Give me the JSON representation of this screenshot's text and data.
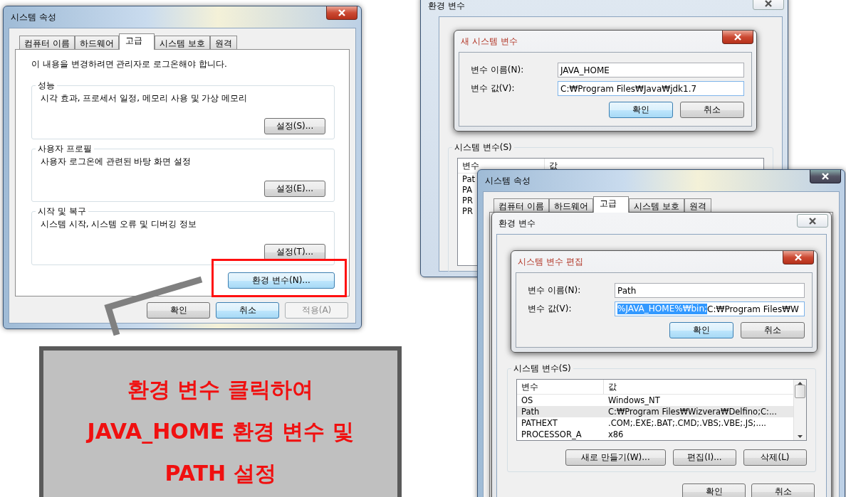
{
  "system_properties": {
    "title": "시스템 속성",
    "tabs": [
      {
        "label": "컴퓨터 이름",
        "selected": false
      },
      {
        "label": "하드웨어",
        "selected": false
      },
      {
        "label": "고급",
        "selected": true
      },
      {
        "label": "시스템 보호",
        "selected": false
      },
      {
        "label": "원격",
        "selected": false
      }
    ],
    "notice": "이 내용을 변경하려면 관리자로 로그온해야 합니다.",
    "groups": [
      {
        "title": "성능",
        "description": "시각 효과, 프로세서 일정, 메모리 사용 및 가상 메모리",
        "button": "설정(S)..."
      },
      {
        "title": "사용자 프로필",
        "description": "사용자 로그온에 관련된 바탕 화면 설정",
        "button": "설정(E)..."
      },
      {
        "title": "시작 및 복구",
        "description": "시스템 시작, 시스템 오류 및 디버깅 정보",
        "button": "설정(T)..."
      }
    ],
    "env_button": {
      "label": "환경 변수(N)...",
      "focused": true,
      "highlighted": true
    },
    "buttons": [
      {
        "label": "확인",
        "focused": false,
        "disabled": false
      },
      {
        "label": "취소",
        "focused": true,
        "disabled": false
      },
      {
        "label": "적용(A)",
        "focused": false,
        "disabled": true
      }
    ]
  },
  "callout": {
    "lines": [
      "환경 변수 클릭하여",
      "JAVA_HOME 환경 변수 및",
      "PATH 설정"
    ]
  },
  "env_window_back": {
    "title": "환경 변수",
    "dialog": {
      "title": "새 시스템 변수",
      "fields": [
        {
          "label": "변수 이름(N):",
          "value": "JAVA_HOME"
        },
        {
          "label": "변수 값(V):",
          "value": "C:₩Program Files₩Java₩jdk1.7"
        }
      ],
      "buttons": [
        {
          "label": "확인",
          "focused": true
        },
        {
          "label": "취소",
          "focused": false
        }
      ]
    },
    "system_vars_title": "시스템 변수(S)",
    "columns": [
      "변수",
      "값"
    ],
    "rows": [
      "Pat",
      "PA",
      "PR",
      "PR"
    ]
  },
  "env_window_front": {
    "window_title": "시스템 속성",
    "tabs": [
      {
        "label": "컴퓨터 이름",
        "selected": false
      },
      {
        "label": "하드웨어",
        "selected": false
      },
      {
        "label": "고급",
        "selected": true
      },
      {
        "label": "시스템 보호",
        "selected": false
      },
      {
        "label": "원격",
        "selected": false
      }
    ],
    "dialog_title": "환경 변수",
    "edit_dialog": {
      "title": "시스템 변수 편집",
      "fields": [
        {
          "label": "변수 이름(N):",
          "value": "Path"
        },
        {
          "label": "변수 값(V):",
          "value_selected": "%JAVA_HOME%₩bin;",
          "value": "C:₩Program Files₩W"
        }
      ],
      "buttons": [
        {
          "label": "확인",
          "focused": true
        },
        {
          "label": "취소",
          "focused": false
        }
      ]
    },
    "system_vars_title": "시스템 변수(S)",
    "columns": [
      "변수",
      "값"
    ],
    "rows": [
      {
        "name": "OS",
        "value": "Windows_NT",
        "selected": false
      },
      {
        "name": "Path",
        "value": "C:₩Program Files₩Wizvera₩Delfino;C:...",
        "selected": true
      },
      {
        "name": "PATHEXT",
        "value": ".COM;.EXE;.BAT;.CMD;.VBS;.VBE;.JS;....",
        "selected": false
      },
      {
        "name": "PROCESSOR_A",
        "value": "x86",
        "selected": false
      }
    ],
    "list_buttons": [
      "새로 만들기(W)...",
      "편집(I)...",
      "삭제(L)"
    ],
    "buttons": [
      {
        "label": "확인",
        "focused": false
      },
      {
        "label": "취소",
        "focused": false
      }
    ]
  }
}
